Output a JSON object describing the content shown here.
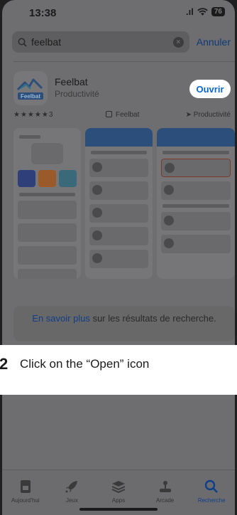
{
  "status": {
    "time": "13:38",
    "battery": "76"
  },
  "search": {
    "query": "feelbat",
    "cancel_label": "Annuler"
  },
  "app": {
    "name": "Feelbat",
    "category": "Productivité",
    "open_label": "Ouvrir",
    "icon_wordmark": "Feelbat"
  },
  "meta": {
    "rating": "★★★★★3",
    "developer": "Feelbat",
    "category": "Productivité"
  },
  "more_info": {
    "link": "En savoir plus",
    "rest": "sur les résultats de recherche."
  },
  "instruction": {
    "step": "2",
    "text": "Click on the “Open” icon"
  },
  "tabs": [
    {
      "label": "Aujourd'hui",
      "icon": "today-icon"
    },
    {
      "label": "Jeux",
      "icon": "rocket-icon"
    },
    {
      "label": "Apps",
      "icon": "apps-stack-icon"
    },
    {
      "label": "Arcade",
      "icon": "joystick-icon"
    },
    {
      "label": "Recherche",
      "icon": "search-icon",
      "active": true
    }
  ],
  "colors": {
    "accent": "#0a66d4",
    "brand": "#2c4e7a"
  }
}
